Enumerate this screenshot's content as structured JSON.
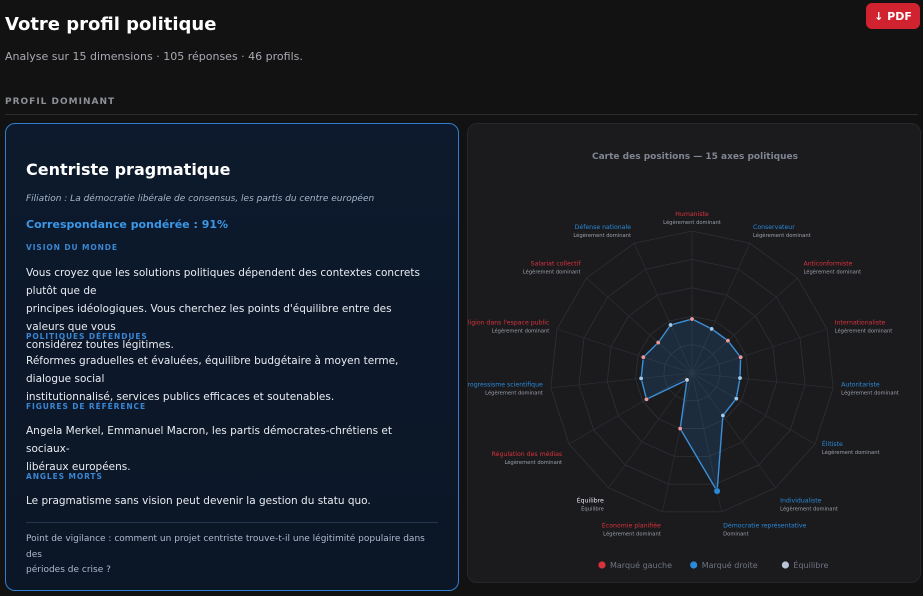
{
  "header": {
    "title": "Votre profil politique",
    "subtitle": "Analyse sur 15 dimensions · 105 réponses · 46 profils.",
    "pdf_label": "↓ PDF"
  },
  "section": {
    "label": "PROFIL DOMINANT"
  },
  "profile": {
    "name": "Centriste pragmatique",
    "filiation": "Filiation : La démocratie libérale de consensus, les partis du centre européen",
    "match": "Correspondance pondérée : 91%",
    "vision_label": "VISION DU MONDE",
    "vision_line1": "Vous croyez que les solutions politiques dépendent des contextes concrets plutôt que de",
    "vision_line2": "principes idéologiques. Vous cherchez les points d'équilibre entre des valeurs que vous",
    "vision_line3": "considérez toutes légitimes.",
    "policies_label": "POLITIQUES DÉFENDUES",
    "policies_line1": "Réformes graduelles et évaluées, équilibre budgétaire à moyen terme, dialogue social",
    "policies_line2": "institutionnalisé, services publics efficaces et soutenables.",
    "figures_label": "FIGURES DE RÉFÉRENCE",
    "figures_line1": "Angela Merkel, Emmanuel Macron, les partis démocrates-chrétiens et sociaux-",
    "figures_line2": "libéraux européens.",
    "blind_label": "ANGLES MORTS",
    "blind_text": "Le pragmatisme sans vision peut devenir la gestion du statu quo.",
    "vigilance_line1": "Point de vigilance : comment un projet centriste trouve-t-il une légitimité populaire dans des",
    "vigilance_line2": "périodes de crise ?"
  },
  "chart_data": {
    "type": "radar",
    "title": "Carte des positions — 15 axes politiques",
    "colors": {
      "gauche": "#d8323c",
      "droite": "#2a8ad8",
      "equilibre": "#b9c4d6",
      "line": "#3a8fd9"
    },
    "axes": [
      {
        "label": "Humaniste",
        "sub": "Légèrement dominant",
        "side": "gauche",
        "value": 0.38
      },
      {
        "label": "Conservateur",
        "sub": "Légèrement dominant",
        "side": "droite",
        "value": 0.34
      },
      {
        "label": "Anticonformiste",
        "sub": "Légèrement dominant",
        "side": "gauche",
        "value": 0.34
      },
      {
        "label": "Internationaliste",
        "sub": "Légèrement dominant",
        "side": "gauche",
        "value": 0.36
      },
      {
        "label": "Autoritariste",
        "sub": "Légèrement dominant",
        "side": "droite",
        "value": 0.34
      },
      {
        "label": "Élitiste",
        "sub": "Légèrement dominant",
        "side": "droite",
        "value": 0.36
      },
      {
        "label": "Individualiste",
        "sub": "Légèrement dominant",
        "side": "droite",
        "value": 0.37
      },
      {
        "label": "Démocratie représentative",
        "sub": "Dominant",
        "side": "droite",
        "value": 0.85
      },
      {
        "label": "Économie planifiée",
        "sub": "Légèrement dominant",
        "side": "gauche",
        "value": 0.4
      },
      {
        "label": "Équilibre",
        "sub": "Équilibre",
        "side": "equilibre",
        "value": 0.06
      },
      {
        "label": "Régulation des médias",
        "sub": "Légèrement dominant",
        "side": "gauche",
        "value": 0.37
      },
      {
        "label": "Progressisme scientifique",
        "sub": "Légèrement dominant",
        "side": "droite",
        "value": 0.36
      },
      {
        "label": "Religion dans l'espace public",
        "sub": "Légèrement dominant",
        "side": "gauche",
        "value": 0.36
      },
      {
        "label": "Salariat collectif",
        "sub": "Légèrement dominant",
        "side": "gauche",
        "value": 0.32
      },
      {
        "label": "Défense nationale",
        "sub": "Légèrement dominant",
        "side": "droite",
        "value": 0.37
      }
    ],
    "rings": 5,
    "legend": [
      {
        "label": "Marqué gauche",
        "color": "#d8323c"
      },
      {
        "label": "Marqué droite",
        "color": "#2a8ad8"
      },
      {
        "label": "Équilibre",
        "color": "#b9c4d6"
      }
    ]
  }
}
